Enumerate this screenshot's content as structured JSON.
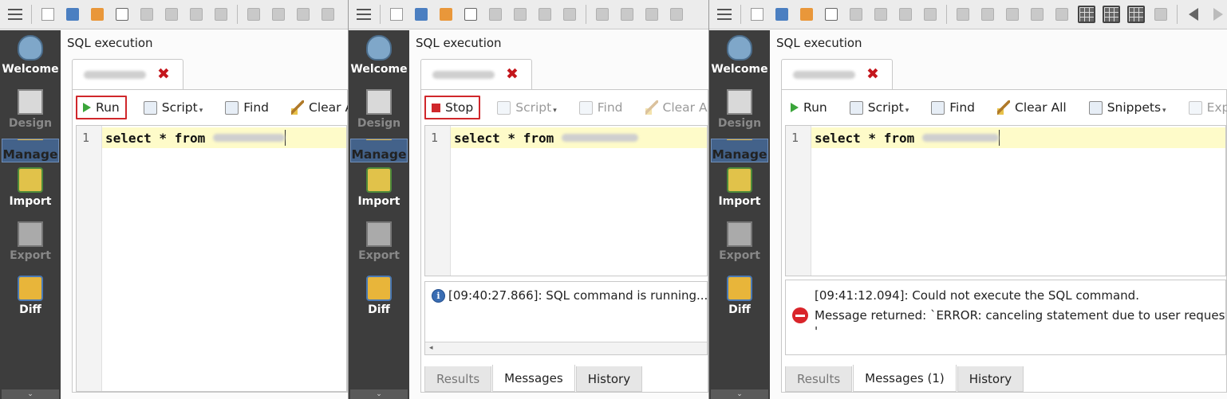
{
  "colors": {
    "sidebar_bg": "#3d3d3d",
    "sidebar_active": "#43628a",
    "highlight_line": "#fefbc9",
    "emphasis_box": "#d0272b",
    "run_green": "#3aa53a"
  },
  "sidebar": {
    "items": [
      {
        "label": "Welcome",
        "icon": "elephant-icon"
      },
      {
        "label": "Design",
        "icon": "design-icon"
      },
      {
        "label": "Manage",
        "icon": "manage-icon"
      },
      {
        "label": "Import",
        "icon": "import-icon"
      },
      {
        "label": "Export",
        "icon": "export-icon"
      },
      {
        "label": "Diff",
        "icon": "diff-icon"
      }
    ],
    "collapse": "⌄"
  },
  "panels": [
    {
      "title": "SQL execution",
      "tab_close": "✖",
      "actions": {
        "run": "Run",
        "script": "Script",
        "find": "Find",
        "clear_all": "Clear All"
      },
      "editor": {
        "line_number": "1",
        "code": "select * from "
      }
    },
    {
      "title": "SQL execution",
      "tab_close": "✖",
      "actions": {
        "stop": "Stop",
        "script": "Script",
        "find": "Find",
        "clear_all": "Clear All"
      },
      "editor": {
        "line_number": "1",
        "code": "select * from "
      },
      "message": {
        "icon": "info-icon",
        "text": "[09:40:27.866]: SQL command is running..."
      },
      "result_tabs": [
        "Results",
        "Messages",
        "History"
      ],
      "scroll_arrow": "◂"
    },
    {
      "title": "SQL execution",
      "tab_close": "✖",
      "actions": {
        "run": "Run",
        "script": "Script",
        "find": "Find",
        "clear_all": "Clear All",
        "snippets": "Snippets",
        "export": "Export"
      },
      "editor": {
        "line_number": "1",
        "code": "select * from "
      },
      "message": {
        "icon": "error-icon",
        "line1": "[09:41:12.094]: Could not execute the SQL command.",
        "line2": "Message returned: `ERROR:  canceling statement due to user request",
        "line3": "'"
      },
      "result_tabs": [
        "Results",
        "Messages (1)",
        "History"
      ]
    }
  ]
}
